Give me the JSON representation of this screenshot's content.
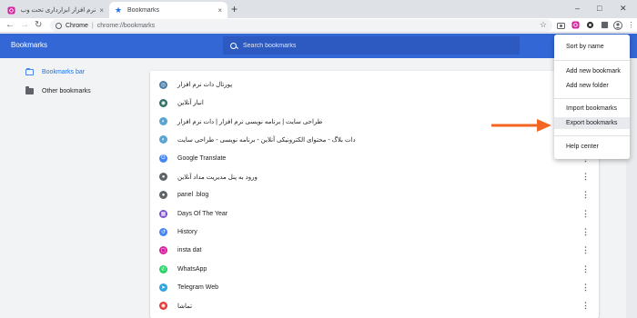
{
  "tabs": [
    {
      "title": "نرم افزار ابزارداری تحت وب (onlin@",
      "close": "×",
      "icon": "instagram-icon"
    },
    {
      "title": "Bookmarks",
      "close": "×",
      "icon": "star-icon"
    }
  ],
  "new_tab": "+",
  "window_controls": {
    "minimize": "–",
    "maximize": "□",
    "close": "✕"
  },
  "toolbar": {
    "back": "←",
    "forward": "→",
    "reload": "↻",
    "scheme": "Chrome",
    "separator": "|",
    "url": "chrome://bookmarks",
    "star": "☆"
  },
  "header": {
    "title": "Bookmarks",
    "search_placeholder": "Search bookmarks"
  },
  "sidebar": {
    "items": [
      {
        "label": "Bookmarks bar",
        "selected": true
      },
      {
        "label": "Other bookmarks",
        "selected": false
      }
    ]
  },
  "bookmarks": [
    {
      "title": "پورتال دات نرم افزار",
      "icon": "site-icon",
      "color": "#4a7fa7",
      "glyph": "◎"
    },
    {
      "title": "انبار آنلاین",
      "icon": "site-icon",
      "color": "#2c6e63",
      "glyph": "◉"
    },
    {
      "title": "طراحی سایت | برنامه نویسی نرم افزار | دات نرم افزار",
      "icon": "site-icon",
      "color": "#5ba3d0",
      "glyph": "◐"
    },
    {
      "title": "دات بلاگ - محتوای الکترونیکی آنلاین - برنامه نویسی - طراحی سایت",
      "icon": "site-icon",
      "color": "#5ba3d0",
      "glyph": "◐"
    },
    {
      "title": "Google Translate",
      "icon": "translate-icon",
      "color": "#4285f4",
      "glyph": "G"
    },
    {
      "title": "ورود به پنل مدیریت مداد آنلاین",
      "icon": "globe-icon",
      "color": "#5f6368",
      "glyph": "●"
    },
    {
      "title": "panel .blog",
      "icon": "globe-icon",
      "color": "#5f6368",
      "glyph": "●"
    },
    {
      "title": "Days Of The Year",
      "icon": "calendar-icon",
      "color": "#7b4fd0",
      "glyph": "▦"
    },
    {
      "title": "History",
      "icon": "history-icon",
      "color": "#4285f4",
      "glyph": "↺"
    },
    {
      "title": "insta dat",
      "icon": "instagram-icon",
      "color": "#d6249f",
      "glyph": "◻"
    },
    {
      "title": "WhatsApp",
      "icon": "whatsapp-icon",
      "color": "#25d366",
      "glyph": "✆"
    },
    {
      "title": "Telegram Web",
      "icon": "telegram-icon",
      "color": "#2ca5e0",
      "glyph": "➤"
    },
    {
      "title": "تماشا",
      "icon": "tamasha-icon",
      "color": "#e53935",
      "glyph": "◉"
    }
  ],
  "kebab": "⋮",
  "menu": {
    "items": [
      {
        "label": "Sort by name"
      },
      {
        "label": "Add new bookmark"
      },
      {
        "label": "Add new folder"
      },
      {
        "label": "Import bookmarks"
      },
      {
        "label": "Export bookmarks",
        "highlighted": true
      },
      {
        "label": "Help center"
      }
    ]
  },
  "accent": "#3367d6",
  "arrow_color": "#f26522"
}
